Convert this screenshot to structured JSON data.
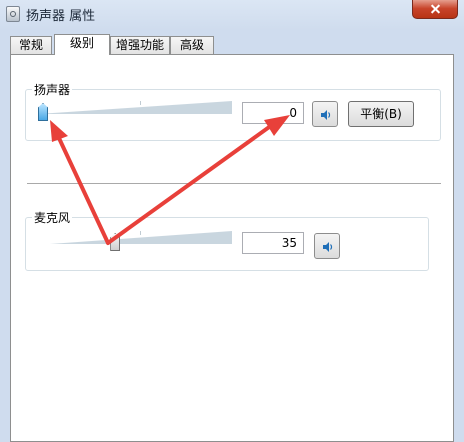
{
  "window": {
    "title": "扬声器 属性"
  },
  "tabs": [
    {
      "label": "常规"
    },
    {
      "label": "级别"
    },
    {
      "label": "增强功能"
    },
    {
      "label": "高级"
    }
  ],
  "speaker": {
    "label": "扬声器",
    "value": "0",
    "level": 0,
    "balance_label": "平衡(B)"
  },
  "microphone": {
    "label": "麦克风",
    "value": "35",
    "level": 35
  },
  "colors": {
    "annotation_arrow": "#e8403a",
    "accent": "#4aa8e6"
  },
  "icons": {
    "speaker": "speaker-icon",
    "microphone_mute": "speaker-icon",
    "window": "speaker-properties-icon"
  }
}
